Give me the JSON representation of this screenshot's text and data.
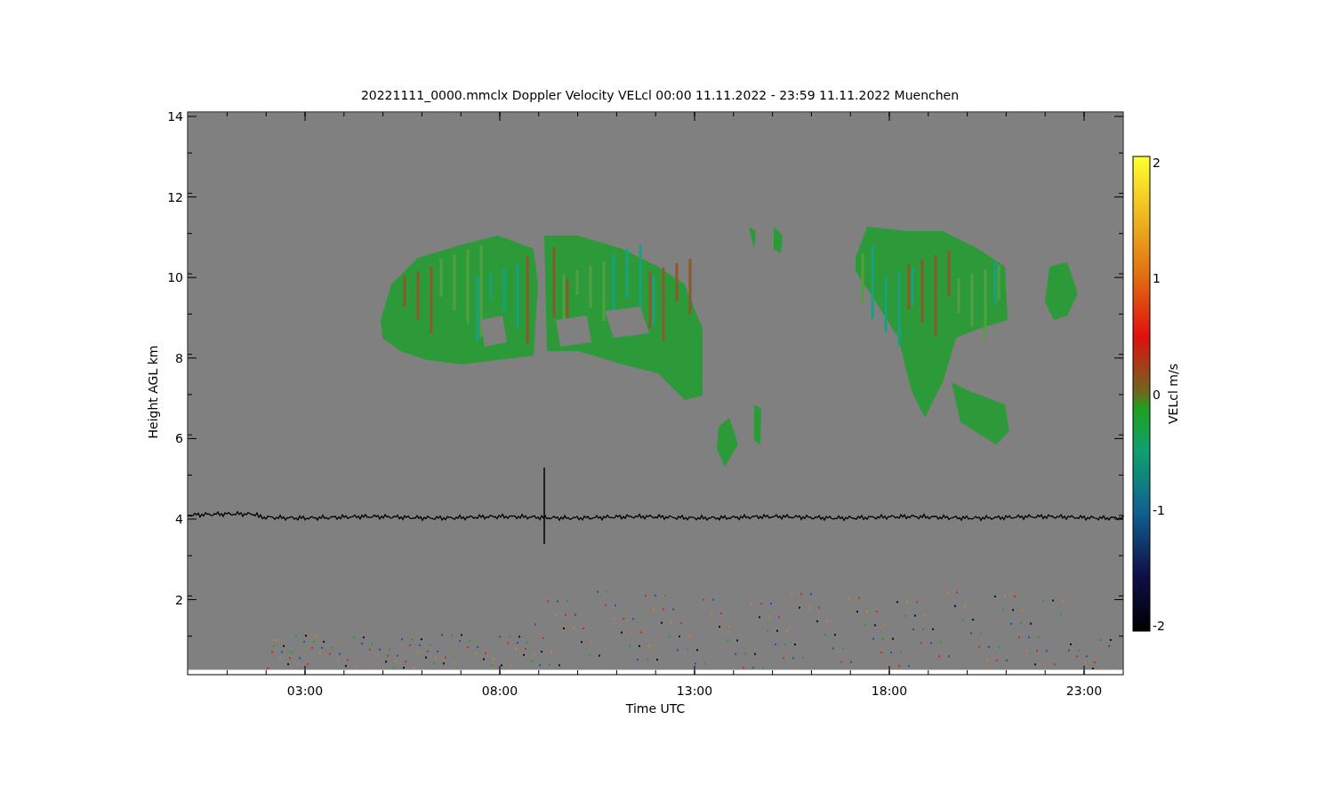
{
  "chart": {
    "title": "20221111_0000.mmclx Doppler Velocity VELcl   00:00 11.11.2022 - 23:59 11.11.2022 Muenchen",
    "y_axis": {
      "label": "Height AGL km",
      "ticks": [
        "14",
        "12",
        "10",
        "8",
        "6",
        "4",
        "2"
      ]
    },
    "x_axis": {
      "label": "Time UTC",
      "ticks": [
        "03:00",
        "08:00",
        "13:00",
        "18:00",
        "23:00"
      ]
    },
    "colorbar": {
      "label": "VELcl m/s",
      "ticks": [
        "2",
        "1",
        "0",
        "-1",
        "-2"
      ]
    }
  }
}
